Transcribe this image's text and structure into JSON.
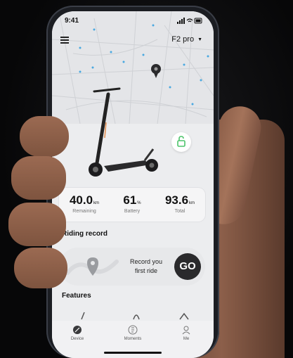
{
  "status": {
    "time": "9:41"
  },
  "header": {
    "model": "F2 pro"
  },
  "stats": [
    {
      "value": "40.0",
      "unit": "km",
      "label": "Remaining"
    },
    {
      "value": "61",
      "unit": "%",
      "label": "Battery"
    },
    {
      "value": "93.6",
      "unit": "km",
      "label": "Total"
    }
  ],
  "riding_record": {
    "title": "Riding record",
    "prompt_line1": "Record you",
    "prompt_line2": "first ride",
    "go_label": "GO"
  },
  "features": {
    "title": "Features"
  },
  "tabs": [
    {
      "label": "Device",
      "icon": "compass-icon"
    },
    {
      "label": "Moments",
      "icon": "moments-icon"
    },
    {
      "label": "Me",
      "icon": "person-icon"
    }
  ],
  "colors": {
    "accent_green": "#4cc46a",
    "map_blue": "#4aa8e0",
    "go_button": "#2a2a2c"
  }
}
